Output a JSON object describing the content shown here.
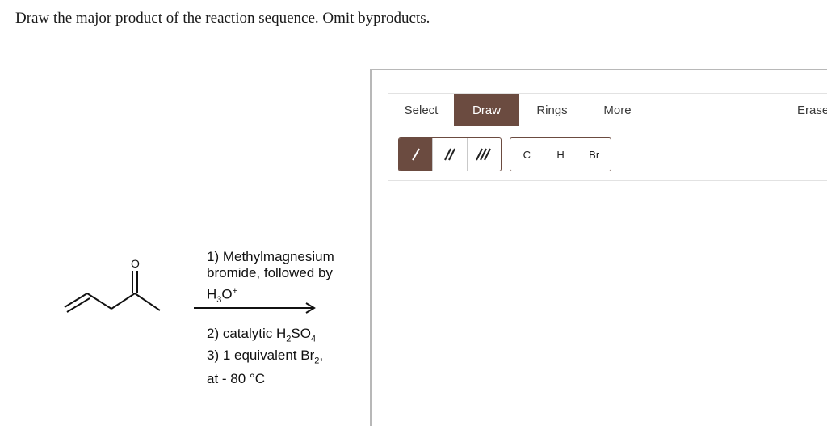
{
  "question": "Draw the major product of the reaction sequence. Omit byproducts.",
  "reactant": {
    "oxygen_label": "O"
  },
  "conditions": {
    "step1_line1": "1) Methylmagnesium",
    "step1_line2": "bromide, followed by",
    "step1_reagent": {
      "base": "H",
      "sub": "3",
      "mid": "O",
      "sup": "+"
    },
    "step2": {
      "prefix": "2) catalytic H",
      "sub1": "2",
      "mid": "SO",
      "sub2": "4"
    },
    "step3": {
      "prefix": "3) 1 equivalent Br",
      "sub": "2",
      "suffix": ","
    },
    "step3_line2": "at - 80 °C"
  },
  "editor": {
    "tabs": [
      {
        "label": "Select",
        "active": false
      },
      {
        "label": "Draw",
        "active": true
      },
      {
        "label": "Rings",
        "active": false
      },
      {
        "label": "More",
        "active": false
      },
      {
        "label": "Erase",
        "active": false
      }
    ],
    "bond_tools": [
      {
        "name": "single-bond",
        "active": true
      },
      {
        "name": "double-bond",
        "active": false
      },
      {
        "name": "triple-bond",
        "active": false
      }
    ],
    "atoms": [
      "C",
      "H",
      "Br"
    ]
  },
  "colors": {
    "accent": "#6b4b40",
    "panel_border": "#b8b8b8"
  }
}
